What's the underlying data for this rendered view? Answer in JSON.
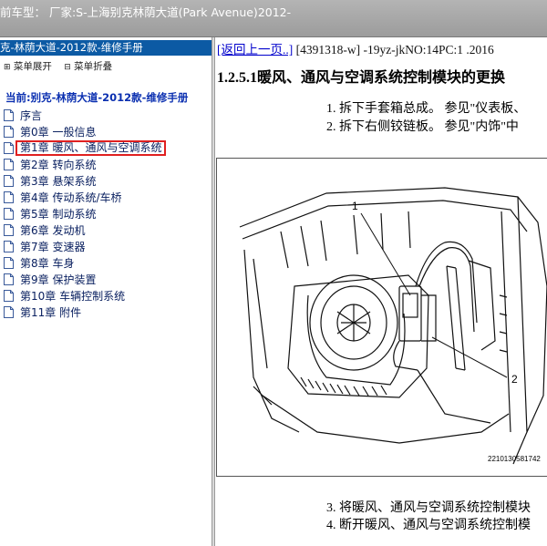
{
  "window": {
    "title": "前车型：  厂家:S-上海别克林荫大道(Park Avenue)2012-"
  },
  "sidebar": {
    "manual_title": "克-林荫大道-2012款-维修手册",
    "toolbar": {
      "expand_label": "菜单展开",
      "collapse_label": "菜单折叠"
    },
    "current_label": "当前:别克-林荫大道-2012款-维修手册",
    "items": [
      {
        "label": "序言"
      },
      {
        "label": "第0章 一般信息"
      },
      {
        "label": "第1章 暖风、通风与空调系统",
        "selected": true
      },
      {
        "label": "第2章 转向系统"
      },
      {
        "label": "第3章 悬架系统"
      },
      {
        "label": "第4章 传动系统/车桥"
      },
      {
        "label": "第5章 制动系统"
      },
      {
        "label": "第6章 发动机"
      },
      {
        "label": "第7章 变速器"
      },
      {
        "label": "第8章 车身"
      },
      {
        "label": "第9章 保护装置"
      },
      {
        "label": "第10章 车辆控制系统"
      },
      {
        "label": "第11章 附件"
      }
    ]
  },
  "content": {
    "back_link": "[返回上一页..]",
    "doc_id": " [4391318-w] -19yz-jkNO:14PC:1 .2016",
    "heading": "1.2.5.1暖风、通风与空调系统控制模块的更换",
    "steps": [
      "1. 拆下手套箱总成。 参见\"仪表板、",
      "2. 拆下右侧铰链板。 参见\"内饰\"中",
      "3. 将暖风、通风与空调系统控制模块",
      "4. 断开暖风、通风与空调系统控制模"
    ],
    "figure": {
      "callout_1": "1",
      "callout_2": "2",
      "figure_id": "2210130581742"
    }
  },
  "colors": {
    "title_bar": "#0c5aa4",
    "selected_outline": "#e02020",
    "link": "#0000cc"
  }
}
